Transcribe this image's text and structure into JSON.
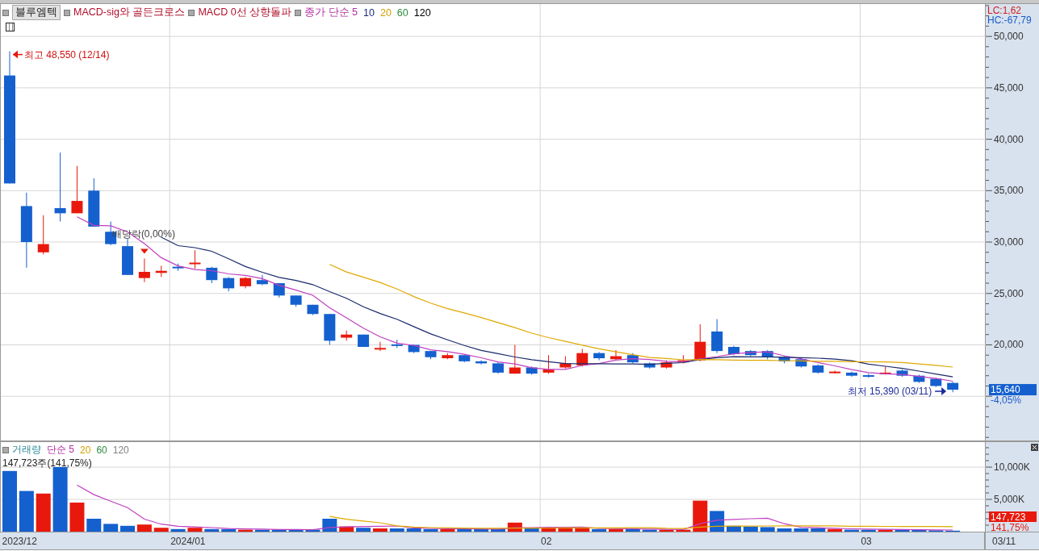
{
  "legend": {
    "stock_button": "블루엠텍",
    "signals": [
      "MACD-sig와 골든크로스",
      "MACD 0선 상향돌파"
    ],
    "ma_label": "종가 단순 5",
    "ma_periods": [
      {
        "label": "10",
        "color": "#1a2a7a"
      },
      {
        "label": "20",
        "color": "#d4a000"
      },
      {
        "label": "60",
        "color": "#2e8b3e"
      },
      {
        "label": "120",
        "color": "#000000"
      }
    ]
  },
  "price_pane": {
    "indicators": [
      {
        "label": "LC:1,62",
        "color": "#d02020"
      },
      {
        "label": "HC:-67,79",
        "color": "#1a5cc8"
      }
    ],
    "y_axis_labels": [
      "50,000",
      "45,000",
      "40,000",
      "35,000",
      "30,000",
      "25,000",
      "20,000"
    ],
    "annotations": [
      {
        "kind": "high",
        "text": "최고 48,550 (12/14)"
      },
      {
        "kind": "event",
        "text": "배당락(0,00%)"
      },
      {
        "kind": "low",
        "text": "최저 15,390 (03/11)"
      }
    ],
    "current_price": "15,640",
    "change": "-4,05%"
  },
  "volume_pane": {
    "legend": {
      "title": "거래량",
      "ma_label": "단순 5",
      "ma_periods": [
        {
          "label": "20",
          "color": "#d4a000"
        },
        {
          "label": "60",
          "color": "#2e8b3e"
        },
        {
          "label": "120",
          "color": "#808080"
        }
      ]
    },
    "reading": "147,723주(141,75%)",
    "y_axis_labels": [
      "10,000K",
      "5,000K"
    ],
    "current_volume": "147,723",
    "ratio": "141,75%"
  },
  "x_axis": {
    "labels": [
      "2023/12",
      "2024/01",
      "02",
      "03"
    ],
    "cursor_date": "03/11"
  }
}
